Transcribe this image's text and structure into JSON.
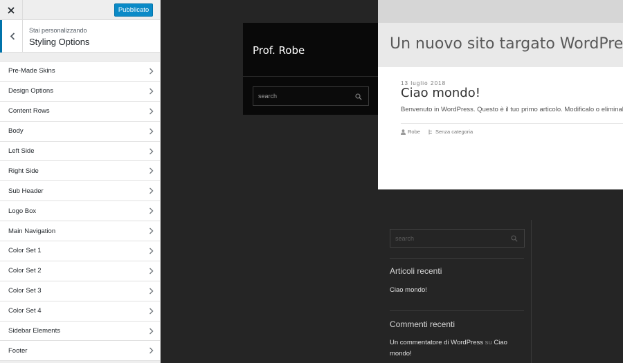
{
  "customizer": {
    "publish_label": "Pubblicato",
    "customizing_label": "Stai personalizzando",
    "section_title": "Styling Options",
    "menu_items": [
      {
        "label": "Pre-Made Skins"
      },
      {
        "label": "Design Options"
      },
      {
        "label": "Content Rows"
      },
      {
        "label": "Body"
      },
      {
        "label": "Left Side"
      },
      {
        "label": "Right Side"
      },
      {
        "label": "Sub Header"
      },
      {
        "label": "Logo Box"
      },
      {
        "label": "Main Navigation"
      },
      {
        "label": "Color Set 1"
      },
      {
        "label": "Color Set 2"
      },
      {
        "label": "Color Set 3"
      },
      {
        "label": "Color Set 4"
      },
      {
        "label": "Sidebar Elements"
      },
      {
        "label": "Footer"
      }
    ]
  },
  "site": {
    "name": "Prof. Robe",
    "tagline": "Un nuovo sito targato WordPress",
    "search_placeholder": "search"
  },
  "post": {
    "date": "13 luglio 2018",
    "title": "Ciao mondo!",
    "excerpt": "Benvenuto in WordPress. Questo è il tuo primo articolo. Modificalo o eliminalo",
    "author": "Robe",
    "category": "Senza categoria"
  },
  "footer_widgets": {
    "search_placeholder": "search",
    "recent_posts_title": "Articoli recenti",
    "recent_posts": [
      "Ciao mondo!"
    ],
    "recent_comments_title": "Commenti recenti",
    "comment_author": "Un commentatore di WordPress",
    "comment_connector": "su",
    "comment_post": "Ciao mondo!"
  },
  "colors": {
    "accent": "#0073aa",
    "publish_bg": "#0a8ac7",
    "preview_bg": "#252525"
  }
}
